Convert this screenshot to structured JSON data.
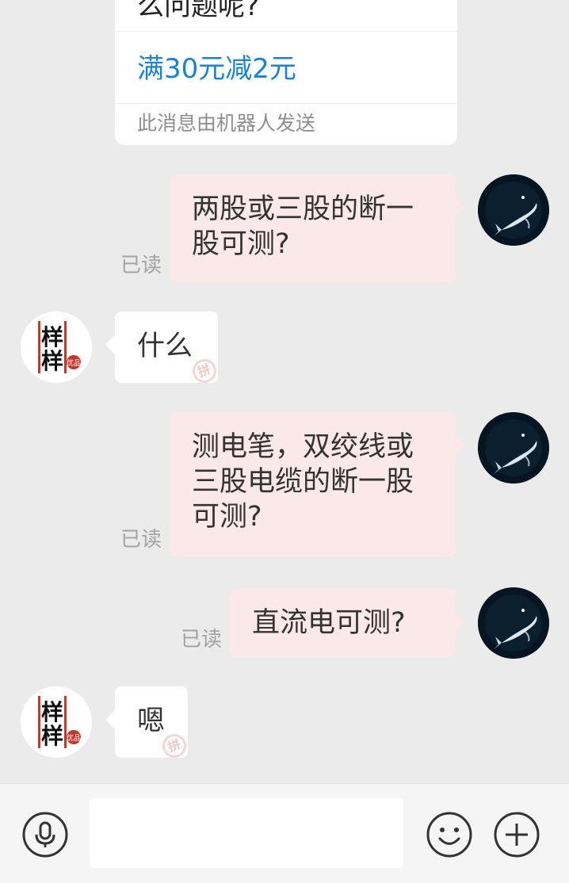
{
  "robot_card": {
    "partial_text": "么问题呢?",
    "promo_link": "满30元减2元",
    "footer_note": "此消息由机器人发送"
  },
  "messages": [
    {
      "sender": "self",
      "text": "两股或三股的断一股可测?",
      "read_status": "已读"
    },
    {
      "sender": "other",
      "text": "什么"
    },
    {
      "sender": "self",
      "text": "测电笔，双绞线或三股电缆的断一股可测?",
      "read_status": "已读"
    },
    {
      "sender": "self",
      "text": "直流电可测?",
      "read_status": "已读"
    },
    {
      "sender": "other",
      "text": "嗯"
    }
  ],
  "watermark_glyph": "拼",
  "shop_avatar": {
    "logo_text": "样样",
    "seal_text": "优品"
  },
  "input_bar": {
    "left_icon": "microphone-icon",
    "right_icons": [
      "emoji-icon",
      "plus-icon"
    ]
  },
  "colors": {
    "background": "#ebebeb",
    "outgoing_bubble": "#fbe8e8",
    "incoming_bubble": "#ffffff",
    "link_blue": "#1b82d2",
    "read_gray": "#a3a3a3"
  }
}
